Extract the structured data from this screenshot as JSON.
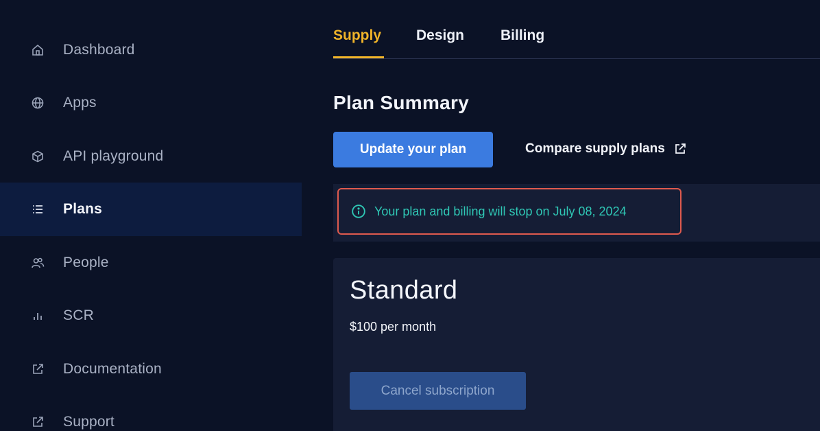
{
  "sidebar": {
    "items": [
      {
        "label": "Dashboard",
        "icon": "home-icon"
      },
      {
        "label": "Apps",
        "icon": "globe-icon"
      },
      {
        "label": "API playground",
        "icon": "cube-icon"
      },
      {
        "label": "Plans",
        "icon": "list-icon",
        "active": true
      },
      {
        "label": "People",
        "icon": "people-icon"
      },
      {
        "label": "SCR",
        "icon": "bar-chart-icon"
      },
      {
        "label": "Documentation",
        "icon": "external-link-icon"
      },
      {
        "label": "Support",
        "icon": "external-link-icon"
      }
    ]
  },
  "tabs": [
    {
      "label": "Supply",
      "active": true
    },
    {
      "label": "Design"
    },
    {
      "label": "Billing"
    }
  ],
  "main": {
    "title": "Plan Summary",
    "update_button": "Update your plan",
    "compare_link": "Compare supply plans",
    "notice": "Your plan and billing will stop on July 08, 2024",
    "plan": {
      "name": "Standard",
      "price": "$100 per month",
      "cancel_button": "Cancel subscription"
    }
  },
  "colors": {
    "background": "#0b1226",
    "accent": "#f0b429",
    "primary": "#3b7be0",
    "notice_text": "#2fc7b5",
    "notice_border": "#e05a4e"
  }
}
